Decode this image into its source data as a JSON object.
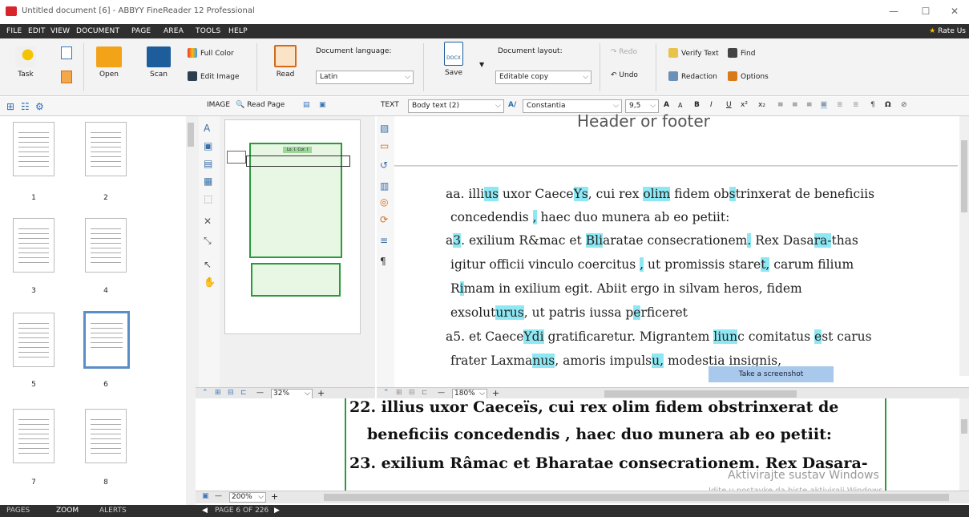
{
  "window": {
    "title": "Untitled document [6] - ABBYY FineReader 12 Professional",
    "min": "—",
    "max": "☐",
    "close": "✕"
  },
  "menu": {
    "items": [
      "FILE",
      "EDIT",
      "VIEW",
      "DOCUMENT",
      "PAGE",
      "AREA",
      "TOOLS",
      "HELP"
    ],
    "rate": "Rate Us"
  },
  "ribbon": {
    "task": "Task",
    "open": "Open",
    "scan": "Scan",
    "full_color": "Full Color",
    "edit_image": "Edit Image",
    "read": "Read",
    "doc_lang_label": "Document language:",
    "doc_lang_value": "Latin",
    "save": "Save",
    "save_badge": "DOCX",
    "layout_label": "Document layout:",
    "layout_value": "Editable copy",
    "redo": "Redo",
    "undo": "Undo",
    "verify": "Verify Text",
    "find": "Find",
    "redaction": "Redaction",
    "options": "Options"
  },
  "image_toolbar": {
    "label": "IMAGE",
    "read_page": "Read Page"
  },
  "text_toolbar": {
    "label": "TEXT",
    "style": "Body text (2)",
    "font": "Constantia",
    "size": "9,5",
    "a_up": "A",
    "a_down": "A",
    "bold": "B",
    "italic": "I",
    "underline": "U",
    "sup": "x²",
    "sub": "x₂",
    "omega": "Ω"
  },
  "pages": {
    "thumbs": [
      "1",
      "2",
      "3",
      "4",
      "5",
      "6",
      "7",
      "8"
    ],
    "selected": "6"
  },
  "image": {
    "header_text": "Lo. I. Cor. I"
  },
  "text": {
    "header_footer": "Header or footer",
    "lines": [
      {
        "s": [
          {
            "t": "aa. illi"
          },
          {
            "t": "us",
            "h": 1
          },
          {
            "t": " uxor Caece"
          },
          {
            "t": "Ys",
            "h": 1
          },
          {
            "t": ", cui rex "
          },
          {
            "t": "olim",
            "h": 1
          },
          {
            "t": " fidem ob"
          },
          {
            "t": "s",
            "h": 1
          },
          {
            "t": "trinxerat de beneficiis"
          }
        ]
      },
      {
        "s": [
          {
            "t": "concedendis "
          },
          {
            "t": ",",
            "h": 1
          },
          {
            "t": " haec duo munera ab eo petiit:"
          }
        ]
      },
      {
        "s": [
          {
            "t": "a"
          },
          {
            "t": "3",
            "h": 1
          },
          {
            "t": ". exilium R&mac et "
          },
          {
            "t": "Bli",
            "h": 1
          },
          {
            "t": "aratae consecrationem"
          },
          {
            "t": ".",
            "h": 1
          },
          {
            "t": " Rex Dasa"
          },
          {
            "t": "ra-",
            "h": 1
          },
          {
            "t": "thas"
          }
        ]
      },
      {
        "s": [
          {
            "t": "igitur officii vinculo coercitus "
          },
          {
            "t": ",",
            "h": 1
          },
          {
            "t": " ut promissis stare"
          },
          {
            "t": "t,",
            "h": 1
          },
          {
            "t": " carum filium"
          }
        ]
      },
      {
        "s": [
          {
            "t": "R"
          },
          {
            "t": "i",
            "h": 1
          },
          {
            "t": "mam in exilium egit. Abiit ergo in silvam heros, fidem"
          }
        ]
      },
      {
        "s": [
          {
            "t": "exsolut"
          },
          {
            "t": "urus",
            "h": 1
          },
          {
            "t": ", ut patris iussa p"
          },
          {
            "t": "e",
            "h": 1
          },
          {
            "t": "rficeret"
          }
        ]
      },
      {
        "s": [
          {
            "t": "a5. et Caece"
          },
          {
            "t": "Ydi",
            "h": 1
          },
          {
            "t": " gratificaretur. Migrantem "
          },
          {
            "t": "liun",
            "h": 1
          },
          {
            "t": "c comitatus "
          },
          {
            "t": "e",
            "h": 1
          },
          {
            "t": "st carus"
          }
        ]
      },
      {
        "s": [
          {
            "t": "frater Laxma"
          },
          {
            "t": "nus",
            "h": 1
          },
          {
            "t": ", amoris impuls"
          },
          {
            "t": "u,",
            "h": 1
          },
          {
            "t": " modestia insignis,"
          }
        ]
      }
    ],
    "tooltip": "Take a screenshot"
  },
  "zoom": {
    "lines": [
      "22. illius uxor Caeceïs, cui rex olim fidem obstrinxerat de",
      "beneficiis concedendis , haec duo munera ab eo petiit:",
      "23. exilium Râmac et Bharatae consecrationem. Rex Dasara-"
    ],
    "watermark1": "Aktivirajte sustav Windows",
    "watermark2": "Idite u postavke da biste aktivirali Windows."
  },
  "zoombars": {
    "img_zoom": "32%",
    "text_zoom": "180%",
    "zoom_zoom": "200%",
    "minus": "—",
    "plus": "+"
  },
  "status": {
    "pages": "PAGES",
    "zoom": "ZOOM",
    "alerts": "ALERTS",
    "page_info": "PAGE 6 OF 226"
  }
}
